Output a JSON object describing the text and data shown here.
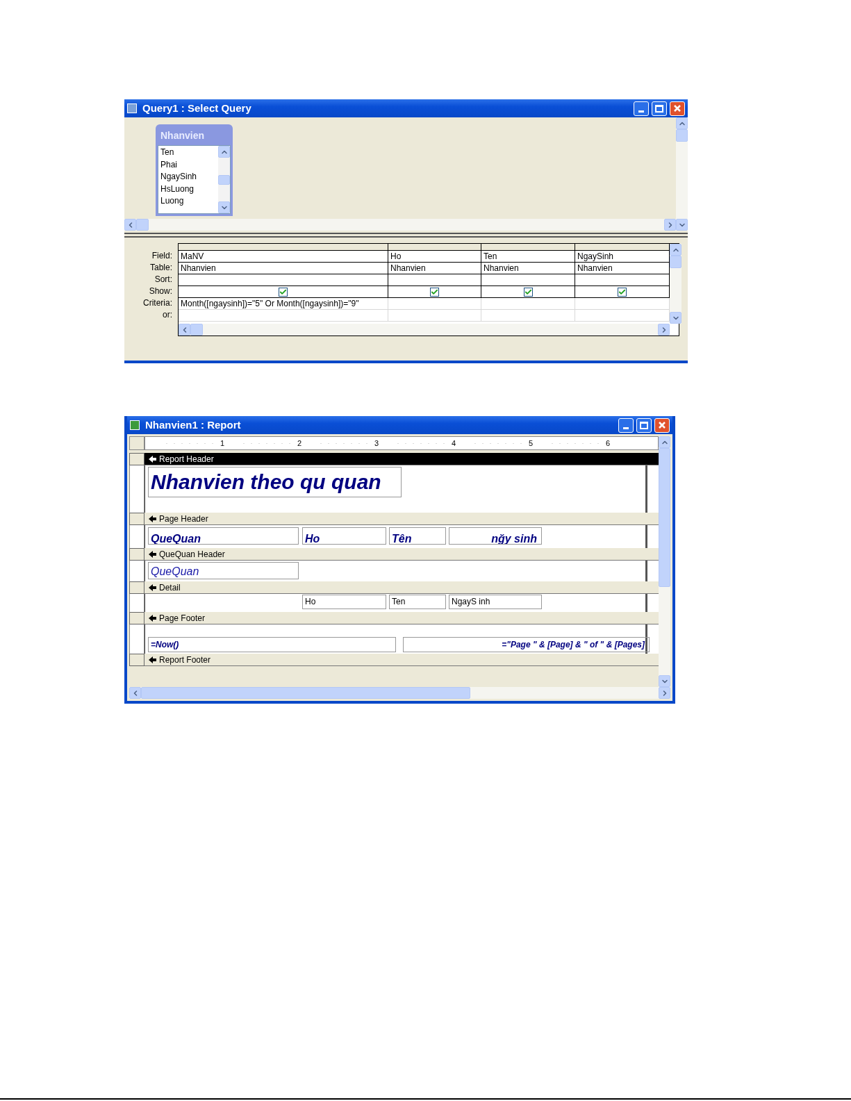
{
  "query_window": {
    "title": "Query1 : Select Query",
    "table_box": {
      "title": "Nhanvien",
      "fields": [
        "Ten",
        "Phai",
        "NgaySinh",
        "HsLuong",
        "Luong"
      ]
    },
    "row_labels": [
      "Field:",
      "Table:",
      "Sort:",
      "Show:",
      "Criteria:",
      "or:"
    ],
    "columns": [
      {
        "field": "MaNV",
        "table": "Nhanvien",
        "show": true,
        "criteria": "Month([ngaysinh])=\"5\" Or Month([ngaysinh])=\"9\""
      },
      {
        "field": "Ho",
        "table": "Nhanvien",
        "show": true
      },
      {
        "field": "Ten",
        "table": "Nhanvien",
        "show": true
      },
      {
        "field": "NgaySinh",
        "table": "Nhanvien",
        "show": true
      }
    ]
  },
  "report_window": {
    "title": "Nhanvien1 : Report",
    "ruler": [
      "1",
      "2",
      "3",
      "4",
      "5",
      "6"
    ],
    "sections": [
      {
        "title": "Report Header",
        "selected": true,
        "controls": [
          {
            "kind": "title",
            "text": "Nhanvien theo qu quan"
          }
        ]
      },
      {
        "title": "Page Header",
        "selected": false,
        "controls": [
          {
            "kind": "heading",
            "text": "QueQuan"
          },
          {
            "kind": "heading",
            "text": "Ho"
          },
          {
            "kind": "heading",
            "text": "Tên"
          },
          {
            "kind": "heading",
            "text": "nğy sinh",
            "right_aligned": true
          }
        ]
      },
      {
        "title": "QueQuan Header",
        "selected": false,
        "controls": [
          {
            "kind": "group",
            "text": "QueQuan"
          }
        ]
      },
      {
        "title": "Detail",
        "selected": false,
        "controls": [
          {
            "kind": "field",
            "text": "Ho"
          },
          {
            "kind": "field",
            "text": "Ten"
          },
          {
            "kind": "field",
            "text": "NgayS inh"
          }
        ]
      },
      {
        "title": "Page Footer",
        "selected": false,
        "controls": [
          {
            "kind": "expression",
            "text": "=Now()"
          },
          {
            "kind": "expression",
            "text": "=\"Page \" & [Page] & \" of \" & [Pages]",
            "right_aligned": true
          }
        ]
      },
      {
        "title": "Report Footer",
        "selected": false
      }
    ]
  }
}
